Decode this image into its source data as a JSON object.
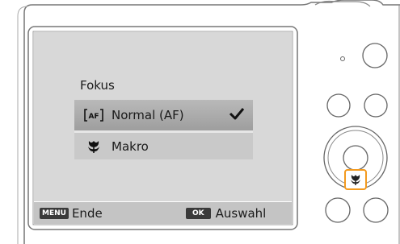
{
  "menu": {
    "title": "Fokus",
    "items": [
      {
        "label": "Normal (AF)",
        "icon": "af-icon",
        "icon_text": "AF",
        "selected": true
      },
      {
        "label": "Makro",
        "icon": "macro-flower-icon",
        "selected": false
      }
    ]
  },
  "footer": {
    "menu_key": "MENU",
    "menu_label": "Ende",
    "ok_key": "OK",
    "ok_label": "Auswahl"
  },
  "colors": {
    "highlight": "#f39a1e",
    "screen_background": "#d8d8d8"
  }
}
